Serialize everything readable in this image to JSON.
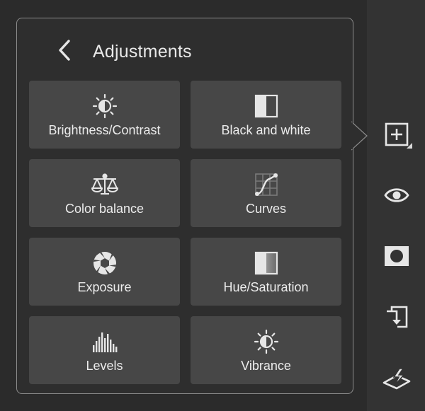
{
  "panel": {
    "title": "Adjustments",
    "back_icon": "chevron-left-icon",
    "tiles": [
      {
        "label": "Brightness/Contrast",
        "icon": "brightness-icon"
      },
      {
        "label": "Black and white",
        "icon": "black-white-icon"
      },
      {
        "label": "Color balance",
        "icon": "scales-icon"
      },
      {
        "label": "Curves",
        "icon": "curves-icon"
      },
      {
        "label": "Exposure",
        "icon": "aperture-icon"
      },
      {
        "label": "Hue/Saturation",
        "icon": "hue-saturation-icon"
      },
      {
        "label": "Levels",
        "icon": "histogram-icon"
      },
      {
        "label": "Vibrance",
        "icon": "vibrance-icon"
      }
    ]
  },
  "toolbar": {
    "items": [
      {
        "icon": "add-adjustment-icon",
        "active": true
      },
      {
        "icon": "visibility-eye-icon"
      },
      {
        "icon": "layer-mask-icon"
      },
      {
        "icon": "clip-to-below-icon"
      },
      {
        "icon": "quick-mask-icon"
      }
    ]
  },
  "colors": {
    "background": "#2b2b2b",
    "panel": "#2e2e2e",
    "tile": "#474747",
    "toolbar": "#333333",
    "text": "#e8e8e8"
  }
}
